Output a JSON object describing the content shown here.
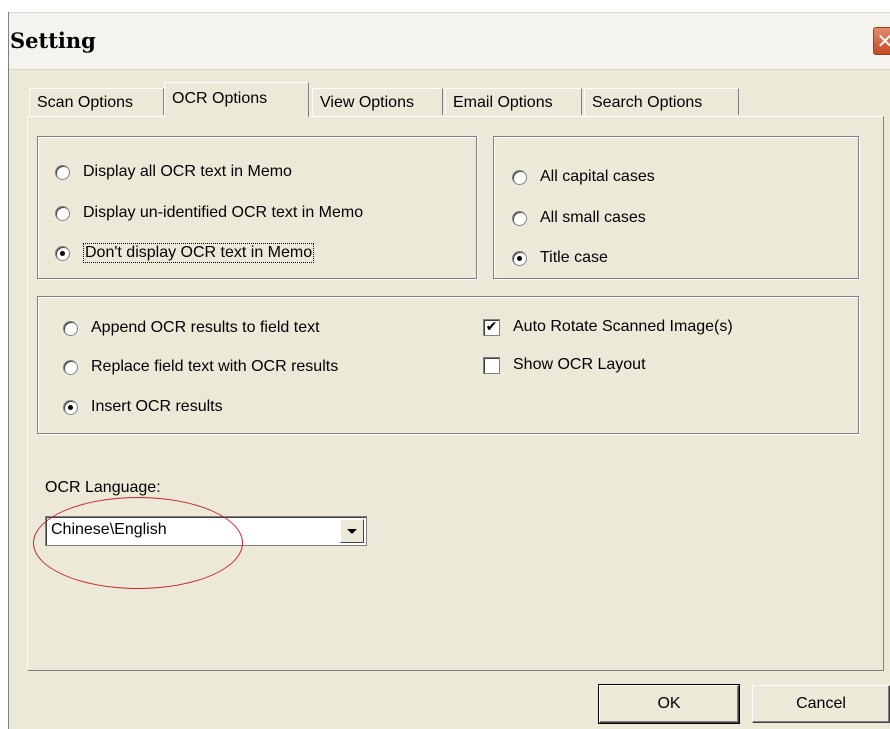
{
  "window": {
    "title": "Setting",
    "close_glyph": "✕"
  },
  "tabs": [
    {
      "label": "Scan Options",
      "active": false
    },
    {
      "label": "OCR Options",
      "active": true
    },
    {
      "label": "View Options",
      "active": false
    },
    {
      "label": "Email Options",
      "active": false
    },
    {
      "label": "Search Options",
      "active": false
    }
  ],
  "memo_display": {
    "options": [
      {
        "label": "Display all OCR text in Memo",
        "checked": false
      },
      {
        "label": "Display un-identified OCR text in Memo",
        "checked": false
      },
      {
        "label": "Don't display OCR text in Memo",
        "checked": true
      }
    ]
  },
  "text_case": {
    "options": [
      {
        "label": "All capital cases",
        "checked": false
      },
      {
        "label": "All small cases",
        "checked": false
      },
      {
        "label": "Title case",
        "checked": true
      }
    ]
  },
  "ocr_results": {
    "options": [
      {
        "label": "Append OCR results to field text",
        "checked": false
      },
      {
        "label": "Replace field text with OCR results",
        "checked": false
      },
      {
        "label": "Insert OCR results",
        "checked": true
      }
    ],
    "checkboxes": [
      {
        "label": "Auto Rotate Scanned Image(s)",
        "checked": true,
        "mark": "✔"
      },
      {
        "label": "Show OCR Layout",
        "checked": false,
        "mark": ""
      }
    ]
  },
  "language": {
    "label": "OCR Language:",
    "value": "Chinese\\English"
  },
  "buttons": {
    "ok": "OK",
    "cancel": "Cancel"
  },
  "colors": {
    "annotation": "#c8282d",
    "dialog_bg": "#ece9d8",
    "close_button": "#c44a25"
  }
}
